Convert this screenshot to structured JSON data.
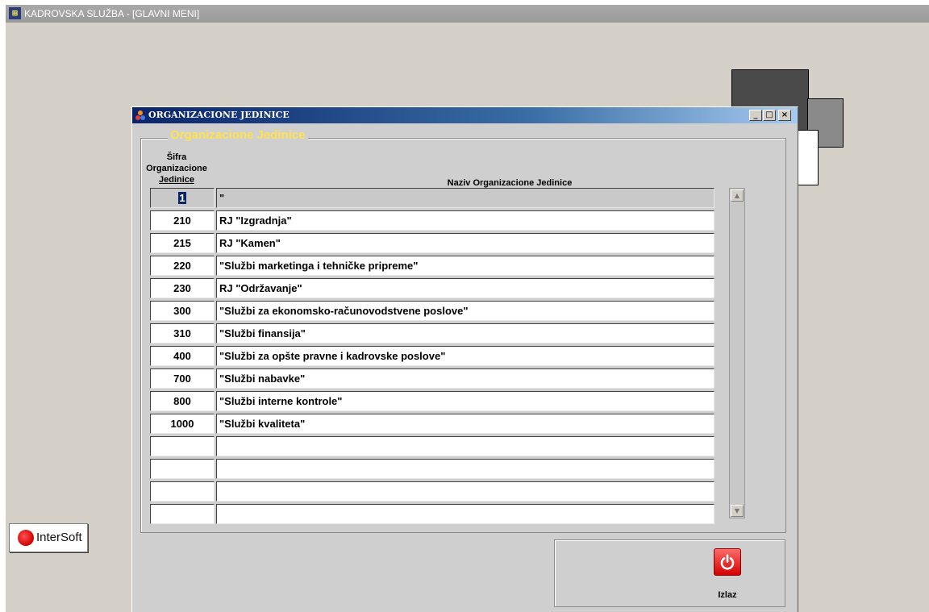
{
  "app": {
    "title": "KADROVSKA SLUŽBA - [GLAVNI MENI]",
    "icon": "app-grid-icon"
  },
  "logo": {
    "text": "InterSoft"
  },
  "window": {
    "title": "ORGANIZACIONE JEDINICE",
    "controls": {
      "minimize": "_",
      "maximize": "□",
      "close": "×"
    },
    "group_title": "Organizacione Jedinice",
    "columns": {
      "code_line1": "Šifra",
      "code_line2": "Organizacione",
      "code_line3": "Jedinice",
      "name": "Naziv Organizacione Jedinice"
    },
    "rows": [
      {
        "code": "1",
        "name": "\""
      },
      {
        "code": "210",
        "name": "RJ \"Izgradnja\""
      },
      {
        "code": "215",
        "name": "RJ \"Kamen\""
      },
      {
        "code": "220",
        "name": "\"Službi marketinga i tehničke pripreme\""
      },
      {
        "code": "230",
        "name": "RJ \"Održavanje\""
      },
      {
        "code": "300",
        "name": "\"Službi za ekonomsko-računovodstvene poslove\""
      },
      {
        "code": "310",
        "name": "\"Službi finansija\""
      },
      {
        "code": "400",
        "name": "\"Službi za opšte pravne i kadrovske poslove\""
      },
      {
        "code": "700",
        "name": "\"Službi nabavke\""
      },
      {
        "code": "800",
        "name": "\"Službi interne kontrole\""
      },
      {
        "code": "1000",
        "name": "\"Službi kvaliteta\""
      },
      {
        "code": "",
        "name": ""
      },
      {
        "code": "",
        "name": ""
      },
      {
        "code": "",
        "name": ""
      },
      {
        "code": "",
        "name": ""
      }
    ],
    "exit_label": "Izlaz"
  },
  "colors": {
    "group_title": "#ffe24d",
    "titlebar": "#0a246a",
    "exit": "#d40000"
  }
}
